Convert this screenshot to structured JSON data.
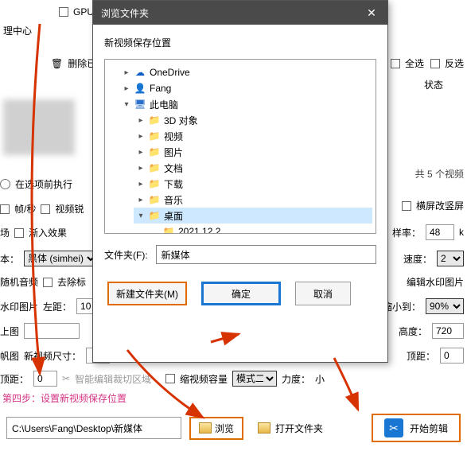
{
  "bg": {
    "gpu_label": "GPU加",
    "mgr": "理中心",
    "delete_sel": "删除已选择",
    "select_all": "全选",
    "invert_sel": "反选",
    "status": "状态",
    "count_label": "共 5 个视频",
    "before_exec": "在选项前执行",
    "fps": "帧/秒",
    "sharpen": "视频锐",
    "landscape": "横屏改竖屏",
    "scene": "场",
    "fade_in": "渐入效果",
    "sample_rate": "样率：",
    "sample_val": "48",
    "sample_unit": "k",
    "font_label": "本：",
    "font_val": "黑体 (simhei)",
    "speed_label": "速度：",
    "speed_val": "2",
    "random_audio": "随机音频",
    "remove": "去除标",
    "edit_wm": "编辑水印图片",
    "wm_img": "水印图片",
    "left_label": "左距：",
    "left_val": "10",
    "shrink_label": "缩小到：",
    "shrink_val": "90%",
    "upload": "上图",
    "height_label": "高度：",
    "height_val": "720",
    "frame_label": "帆图",
    "new_size": "新视频尺寸：",
    "top_label": "顶距：",
    "top_val": "0",
    "crop_label": "顶距：",
    "crop_val": "0",
    "scissors_ico": "✂",
    "smart_crop": "智能编辑裁切区域",
    "compress": "缩视频容量",
    "mode_val": "模式二",
    "intensity": "力度：",
    "intensity_val": "小"
  },
  "step": "第四步：设置新视频保存位置",
  "bottom": {
    "path": "C:\\Users\\Fang\\Desktop\\新媒体",
    "browse": "浏览",
    "open_folder": "打开文件夹",
    "start": "开始剪辑"
  },
  "dialog": {
    "title": "浏览文件夹",
    "subtitle": "新视频保存位置",
    "tree": [
      {
        "label": "OneDrive",
        "icon": "onedrive",
        "arrow": ">",
        "ind": 1
      },
      {
        "label": "Fang",
        "icon": "user",
        "arrow": ">",
        "ind": 1
      },
      {
        "label": "此电脑",
        "icon": "pc",
        "arrow": "v",
        "ind": 1
      },
      {
        "label": "3D 对象",
        "icon": "folder",
        "arrow": ">",
        "ind": 2
      },
      {
        "label": "视频",
        "icon": "folder",
        "arrow": ">",
        "ind": 2
      },
      {
        "label": "图片",
        "icon": "folder",
        "arrow": ">",
        "ind": 2
      },
      {
        "label": "文档",
        "icon": "folder",
        "arrow": ">",
        "ind": 2
      },
      {
        "label": "下载",
        "icon": "folder",
        "arrow": ">",
        "ind": 2
      },
      {
        "label": "音乐",
        "icon": "folder",
        "arrow": ">",
        "ind": 2
      },
      {
        "label": "桌面",
        "icon": "folder",
        "arrow": "v",
        "ind": 2,
        "sel": true
      },
      {
        "label": "2021.12.2",
        "icon": "folder",
        "arrow": "",
        "ind": 3
      }
    ],
    "folder_label": "文件夹(F):",
    "folder_val": "新媒体",
    "new_folder": "新建文件夹(M)",
    "ok": "确定",
    "cancel": "取消"
  }
}
